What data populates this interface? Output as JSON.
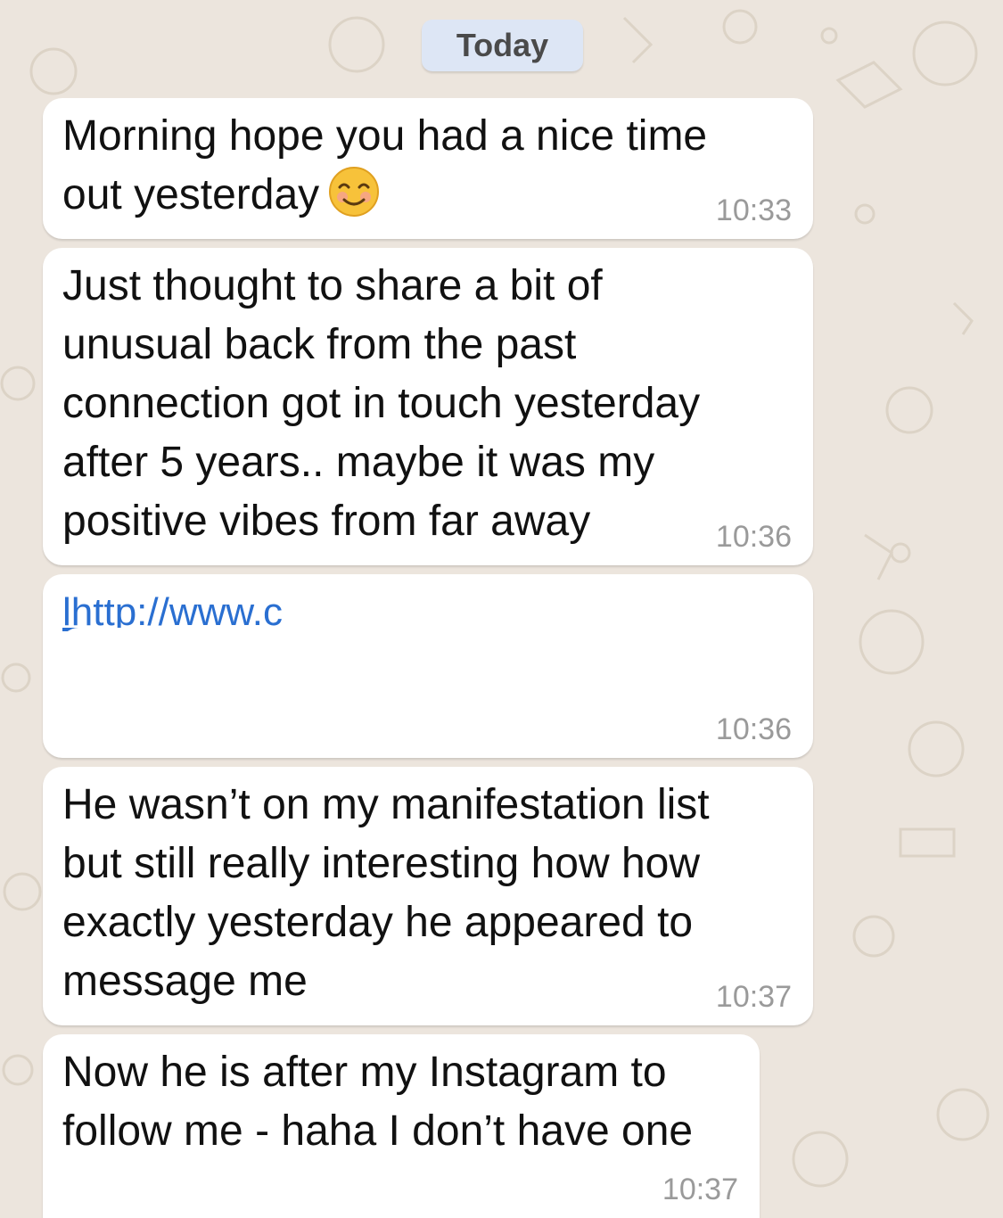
{
  "date_divider": "Today",
  "messages": [
    {
      "text": "Morning hope you had a nice time\nout yesterday",
      "emoji": "smiling-face-emoji",
      "time": "10:33"
    },
    {
      "text": "Just thought to share a bit of\nunusual back from the past\nconnection got in touch yesterday\nafter 5 years.. maybe it was my\npositive vibes from far away",
      "time": "10:36"
    },
    {
      "link_text": "lhttp://www.c",
      "time": "10:36"
    },
    {
      "text": "He wasn’t on my manifestation list\nbut still really interesting how how\nexactly yesterday he appeared to\nmessage me",
      "time": "10:37"
    },
    {
      "text": "Now he is after my Instagram to\nfollow me - haha I don’t have one",
      "time": "10:37"
    }
  ],
  "colors": {
    "background": "#ece5dd",
    "bubble": "#ffffff",
    "date_chip": "#dde6f5",
    "link": "#2a6fd1",
    "timestamp": "#9a9a9a"
  }
}
